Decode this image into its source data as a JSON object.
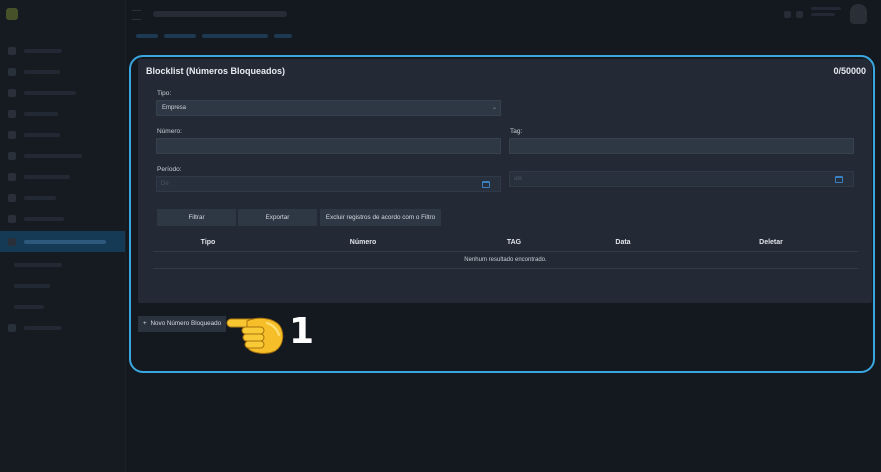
{
  "card": {
    "title": "Blocklist (Números Bloqueados)",
    "counter": "0/50000"
  },
  "filters": {
    "tipo_label": "Tipo:",
    "tipo_value": "Empresa",
    "numero_label": "Número:",
    "tag_label": "Tag:",
    "periodo_label": "Período:",
    "periodo_de_placeholder": "De",
    "periodo_ate_placeholder": "até"
  },
  "buttons": {
    "filtrar": "Filtrar",
    "exportar": "Exportar",
    "excluir": "Excluir registros de acordo com o Filtro",
    "novo": "Novo Número Bloqueado",
    "novo_prefix": "+"
  },
  "table": {
    "columns": [
      "Tipo",
      "Número",
      "TAG",
      "Data",
      "Deletar"
    ],
    "empty_message": "Nenhum resultado encontrado."
  },
  "annotation": {
    "step_number": "1",
    "highlight_color": "#3aa7df"
  },
  "icons": [
    "calendar-icon",
    "chevron-down-icon",
    "pointing-hand-icon",
    "menu-icon"
  ]
}
